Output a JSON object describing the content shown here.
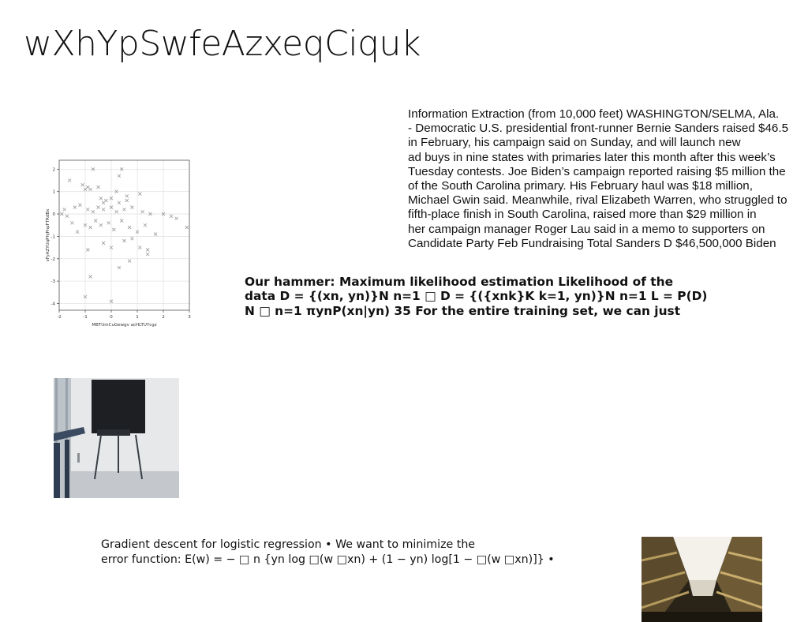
{
  "slide": {
    "title": "wXhYpSwfeAzxeqCiquk"
  },
  "news_block": {
    "lines": [
      "Information Extraction (from 10,000 feet) WASHINGTON/SELMA, Ala.",
      "- Democratic U.S. presidential front-runner Bernie Sanders raised $46.5",
      "in February, his campaign said on Sunday, and will launch new",
      "ad buys in nine states with primaries later this month after this week’s",
      "Tuesday contests. Joe Biden’s campaign reported raising $5 million the",
      "of the South Carolina primary. His February haul was $18 million,",
      "Michael Gwin said. Meanwhile, rival Elizabeth Warren, who struggled to",
      "fifth-place finish in South Carolina, raised more than $29 million in",
      "her campaign manager Roger Lau said in a memo to supporters on",
      "Candidate Party Feb Fundraising Total Sanders D $46,500,000 Biden"
    ]
  },
  "mle_block": {
    "lines": [
      "Our hammer: Maximum likelihood estimation Likelihood of the",
      "data D = {(xn, yn)}N n=1 □ D = {({xnk}K k=1, yn)}N n=1 L = P(D)",
      "N □ n=1 πynP(xn|yn) 35 For the entire training set, we can just"
    ]
  },
  "gradient_block": {
    "lines": [
      "Gradient descent for logistic regression • We want to minimize the",
      "error function: E(w) = − □ n {yn log □(w □xn) + (1 − yn) log[1 − □(w □xn)]} •"
    ]
  },
  "chart_data": {
    "type": "scatter",
    "xlabel": "MBTUmCuGewgv acHLTUYcgz",
    "ylabel": "vFyAZYUqPhjPnpFTRdBx",
    "xlim": [
      -2,
      3
    ],
    "ylim": [
      -4.3,
      2.4
    ],
    "xticks": [
      -2,
      -1,
      0,
      1,
      2,
      3
    ],
    "yticks": [
      -4,
      -3,
      -2,
      -1,
      0,
      1,
      2
    ],
    "grid": true,
    "marker": "x",
    "marker_color": "#9a9a9a",
    "points": [
      [
        -1.6,
        1.5
      ],
      [
        -0.7,
        2.0
      ],
      [
        0.4,
        2.0
      ],
      [
        0.3,
        1.7
      ],
      [
        -1.1,
        1.3
      ],
      [
        -1.0,
        1.1
      ],
      [
        -0.9,
        1.2
      ],
      [
        -0.8,
        1.1
      ],
      [
        -0.5,
        1.2
      ],
      [
        0.2,
        1.0
      ],
      [
        0.6,
        0.8
      ],
      [
        1.1,
        0.9
      ],
      [
        -0.4,
        0.7
      ],
      [
        -0.3,
        0.5
      ],
      [
        -0.2,
        0.6
      ],
      [
        0.0,
        0.7
      ],
      [
        0.3,
        0.5
      ],
      [
        0.6,
        0.6
      ],
      [
        -1.4,
        0.3
      ],
      [
        -1.2,
        0.4
      ],
      [
        -0.9,
        0.2
      ],
      [
        -0.7,
        0.1
      ],
      [
        -0.5,
        0.3
      ],
      [
        -0.3,
        0.2
      ],
      [
        0.0,
        0.3
      ],
      [
        0.2,
        0.1
      ],
      [
        0.5,
        0.2
      ],
      [
        0.8,
        0.3
      ],
      [
        1.2,
        0.1
      ],
      [
        1.5,
        0.0
      ],
      [
        2.0,
        0.0
      ],
      [
        2.3,
        -0.1
      ],
      [
        2.5,
        -0.2
      ],
      [
        -1.8,
        0.2
      ],
      [
        -1.7,
        -0.1
      ],
      [
        -1.5,
        -0.4
      ],
      [
        -1.3,
        -0.8
      ],
      [
        -1.0,
        -0.5
      ],
      [
        -0.8,
        -0.6
      ],
      [
        -0.6,
        -0.3
      ],
      [
        -0.4,
        -0.5
      ],
      [
        -0.1,
        -0.4
      ],
      [
        0.1,
        -0.7
      ],
      [
        0.4,
        -0.3
      ],
      [
        0.7,
        -0.6
      ],
      [
        1.0,
        -0.8
      ],
      [
        1.3,
        -0.5
      ],
      [
        1.7,
        -0.9
      ],
      [
        2.9,
        -0.6
      ],
      [
        -0.9,
        -1.6
      ],
      [
        -0.3,
        -1.3
      ],
      [
        0.0,
        -1.5
      ],
      [
        0.5,
        -1.2
      ],
      [
        0.8,
        -1.1
      ],
      [
        1.1,
        -1.5
      ],
      [
        1.4,
        -1.6
      ],
      [
        1.4,
        -1.8
      ],
      [
        0.7,
        -2.1
      ],
      [
        0.3,
        -2.4
      ],
      [
        -0.8,
        -2.8
      ],
      [
        -1.0,
        -3.7
      ],
      [
        0.0,
        -3.9
      ],
      [
        -1.9,
        0.0
      ]
    ]
  },
  "photos": [
    {
      "name": "photo-chair-room"
    },
    {
      "name": "photo-building-courtyard"
    }
  ]
}
